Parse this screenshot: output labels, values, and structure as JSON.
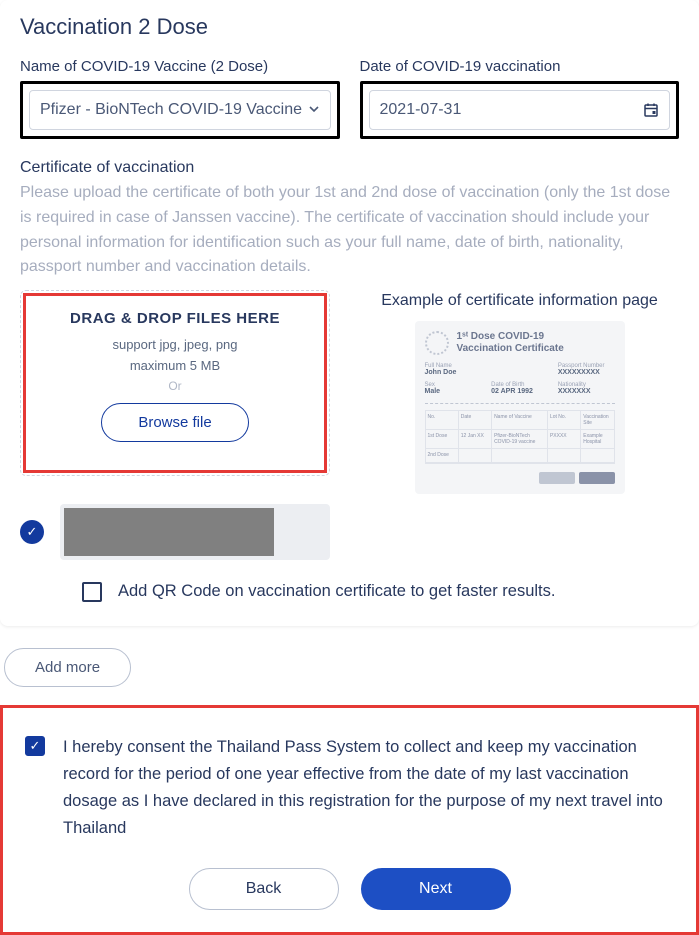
{
  "section": {
    "title": "Vaccination 2 Dose"
  },
  "vaccine": {
    "name_label": "Name of COVID-19 Vaccine (2 Dose)",
    "name_value": "Pfizer - BioNTech COVID-19 Vaccine",
    "date_label": "Date of COVID-19 vaccination",
    "date_value": "2021-07-31"
  },
  "certificate": {
    "label": "Certificate of vaccination",
    "desc": "Please upload the certificate of both your 1st and 2nd dose of vaccination (only the 1st dose is required in case of Janssen vaccine). The certificate of vaccination should include your personal information for identification such as your full name, date of birth, nationality, passport number and vaccination details."
  },
  "upload": {
    "title": "DRAG & DROP FILES HERE",
    "formats": "support jpg, jpeg, png",
    "max": "maximum 5 MB",
    "or": "Or",
    "browse": "Browse file"
  },
  "example": {
    "title": "Example of certificate information page",
    "heading_line1": "1ˢᵗ Dose COVID-19",
    "heading_line2": "Vaccination Certificate",
    "name_lbl": "Full Name",
    "name_val": "John Doe",
    "pass_lbl": "Passport Number",
    "pass_val": "XXXXXXXXX",
    "sex_lbl": "Sex",
    "sex_val": "Male",
    "dob_lbl": "Date of Birth",
    "dob_val": "02 APR 1992",
    "nat_lbl": "Nationality",
    "nat_val": "XXXXXXX",
    "th": [
      "No.",
      "Date",
      "Name of Vaccine",
      "Lot No.",
      "Vaccination Site"
    ],
    "row1": [
      "1st Dose",
      "12 Jan XX",
      "Pfizer-BioNTech COVID-19 vaccine",
      "PXXXX",
      "Example Hospital"
    ],
    "row2_label": "2nd Dose"
  },
  "qr": {
    "label": "Add QR Code on vaccination certificate to get faster results."
  },
  "add_more": "Add more",
  "consent": "I hereby consent the Thailand Pass System to collect and keep my vaccination record for the period of one year effective from the date of my last vaccination dosage as I have declared in this registration for the purpose of my next travel into Thailand",
  "nav": {
    "back": "Back",
    "next": "Next"
  }
}
